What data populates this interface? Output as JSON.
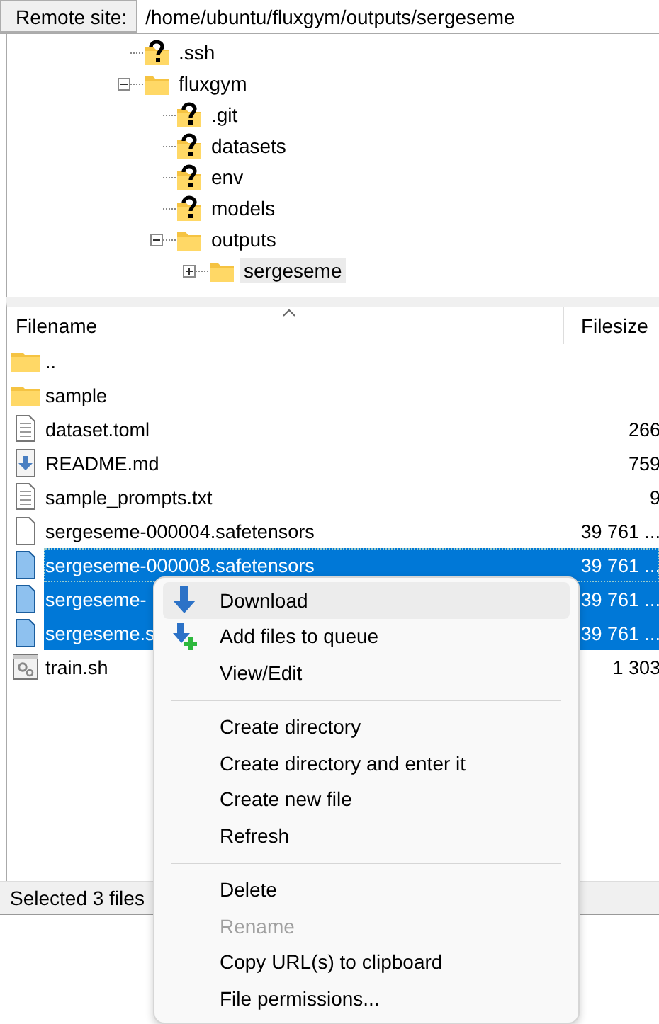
{
  "remote_site": {
    "label": "Remote site:",
    "path": "/home/ubuntu/fluxgym/outputs/sergeseme"
  },
  "tree": [
    {
      "name": ".ssh",
      "kind": "unknown",
      "selected": false
    },
    {
      "name": "fluxgym",
      "kind": "folder",
      "expanded": true,
      "selected": false,
      "children": [
        {
          "name": ".git",
          "kind": "unknown",
          "selected": false
        },
        {
          "name": "datasets",
          "kind": "unknown",
          "selected": false
        },
        {
          "name": "env",
          "kind": "unknown",
          "selected": false
        },
        {
          "name": "models",
          "kind": "unknown",
          "selected": false
        },
        {
          "name": "outputs",
          "kind": "folder",
          "expanded": true,
          "selected": false,
          "children": [
            {
              "name": "sergeseme",
              "kind": "folder",
              "expanded": false,
              "selected": true
            }
          ]
        }
      ]
    }
  ],
  "file_list": {
    "columns": [
      "Filename",
      "Filesize"
    ],
    "rows": [
      {
        "name": "..",
        "kind": "folder",
        "selected": false
      },
      {
        "name": "sample",
        "kind": "folder",
        "selected": false
      },
      {
        "name": "dataset.toml",
        "kind": "text",
        "size": "266",
        "selected": false
      },
      {
        "name": "README.md",
        "kind": "markdown",
        "size": "759",
        "selected": false
      },
      {
        "name": "sample_prompts.txt",
        "kind": "text",
        "size": "9",
        "selected": false
      },
      {
        "name": "sergeseme-000004.safetensors",
        "kind": "file",
        "size": "39 761 ...",
        "selected": false
      },
      {
        "name": "sergeseme-000008.safetensors",
        "kind": "file",
        "size": "39 761 ...",
        "selected": true
      },
      {
        "name": "sergeseme-",
        "kind": "file",
        "size": "39 761 ...",
        "selected": true
      },
      {
        "name": "sergeseme.s",
        "kind": "file",
        "size": "39 761 ...",
        "selected": true
      },
      {
        "name": "train.sh",
        "kind": "script",
        "size": "1 303",
        "selected": false
      }
    ]
  },
  "status_bar": "Selected 3 files",
  "context_menu": [
    [
      {
        "label": "Download",
        "kind": "download",
        "highlighted": true,
        "disabled": false
      },
      {
        "label": "Add files to queue",
        "kind": "queue",
        "highlighted": false,
        "disabled": false
      },
      {
        "label": "View/Edit",
        "highlighted": false,
        "disabled": false
      }
    ],
    [
      {
        "label": "Create directory",
        "highlighted": false,
        "disabled": false
      },
      {
        "label": "Create directory and enter it",
        "highlighted": false,
        "disabled": false
      },
      {
        "label": "Create new file",
        "highlighted": false,
        "disabled": false
      },
      {
        "label": "Refresh",
        "highlighted": false,
        "disabled": false
      }
    ],
    [
      {
        "label": "Delete",
        "highlighted": false,
        "disabled": false
      },
      {
        "label": "Rename",
        "highlighted": false,
        "disabled": true
      },
      {
        "label": "Copy URL(s) to clipboard",
        "highlighted": false,
        "disabled": false
      },
      {
        "label": "File permissions...",
        "highlighted": false,
        "disabled": false
      }
    ]
  ]
}
